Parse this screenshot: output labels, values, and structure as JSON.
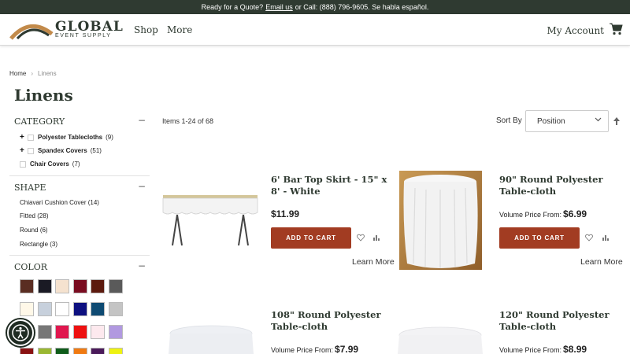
{
  "topbar": {
    "prefix": "Ready for a Quote?",
    "email_link": "Email us",
    "suffix": "or Call: (888) 796-9605. Se habla español."
  },
  "brand": {
    "name": "GLOBAL",
    "tagline": "EVENT SUPPLY"
  },
  "nav": {
    "shop": "Shop",
    "more": "More",
    "account": "My Account",
    "cart_icon": "cart-icon"
  },
  "breadcrumb": {
    "home": "Home",
    "separator": "›",
    "current": "Linens"
  },
  "page_title": "Linens",
  "filters": {
    "category": {
      "title": "CATEGORY",
      "items": [
        {
          "label": "Polyester Tablecloths",
          "count": "(9)",
          "expandable": "+"
        },
        {
          "label": "Spandex Covers",
          "count": "(51)",
          "expandable": "+"
        },
        {
          "label": "Chair Covers",
          "count": "(7)"
        }
      ]
    },
    "shape": {
      "title": "SHAPE",
      "items": [
        {
          "label": "Chiavari Cushion Cover",
          "count": "(14)"
        },
        {
          "label": "Fitted",
          "count": "(28)"
        },
        {
          "label": "Round",
          "count": "(6)"
        },
        {
          "label": "Rectangle",
          "count": "(3)"
        }
      ]
    },
    "color": {
      "title": "COLOR",
      "swatches": [
        "#5a2d22",
        "#1a1a24",
        "#f5e2cf",
        "#7a0c20",
        "#5c1a0e",
        "#5a5a5a",
        "#fff8e8",
        "#c7d0dc",
        "#ffffff",
        "#0d1080",
        "#0e4a72",
        "#c4c4c4",
        "#e8e8e8",
        "#777777",
        "#e0174f",
        "#ee1111",
        "#fde9ee",
        "#b199e0",
        "#8a1212",
        "#9ab832",
        "#0f5c1a",
        "#f07a12",
        "#4a1a5a",
        "#eef211"
      ]
    },
    "collapse_symbol": "−"
  },
  "toolbar": {
    "items_count": "Items 1-24 of 68",
    "sort_label": "Sort By",
    "sort_value": "Position"
  },
  "products": [
    {
      "name": "6' Bar Top Skirt - 15\" x 8' - White",
      "price": "$11.99",
      "button": "ADD TO CART",
      "learn": "Learn More"
    },
    {
      "name": "90\" Round Polyester Table-cloth",
      "price_prefix": "Volume Price From:",
      "price": "$6.99",
      "button": "ADD TO CART",
      "learn": "Learn More"
    },
    {
      "name": "108\" Round Polyester Table-cloth",
      "price_prefix": "Volume Price From:",
      "price": "$7.99"
    },
    {
      "name": "120\" Round Polyester Table-cloth",
      "price_prefix": "Volume Price From:",
      "price": "$8.99"
    }
  ],
  "colors": {
    "brand_green": "#2f3a31",
    "button_red": "#a23c22",
    "topbar_bg": "#2f3a31"
  }
}
